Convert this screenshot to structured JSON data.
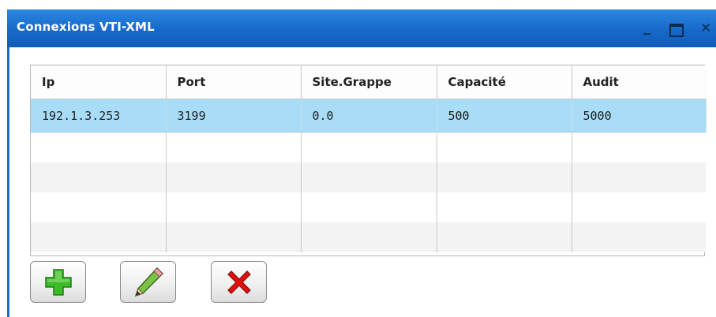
{
  "window": {
    "title": "Connexions VTI-XML",
    "controls": [
      "minimize-icon",
      "maximize-icon",
      "close-icon"
    ]
  },
  "table": {
    "columns": [
      "Ip",
      "Port",
      "Site.Grappe",
      "Capacité",
      "Audit"
    ],
    "rows": [
      [
        "192.1.3.253",
        "3199",
        "0.0",
        "500",
        "5000"
      ]
    ],
    "selected_row": 0,
    "selection_color": "#a9ddf7"
  },
  "toolbar": {
    "buttons": [
      {
        "icon": "add-icon",
        "color": "#3dbb2a"
      },
      {
        "icon": "pencil-icon",
        "color": "#6ab23b"
      },
      {
        "icon": "delete-icon",
        "color": "#e01010"
      }
    ]
  },
  "colors": {
    "titlebar": "#1769c9",
    "title_text": "#ffffff"
  }
}
